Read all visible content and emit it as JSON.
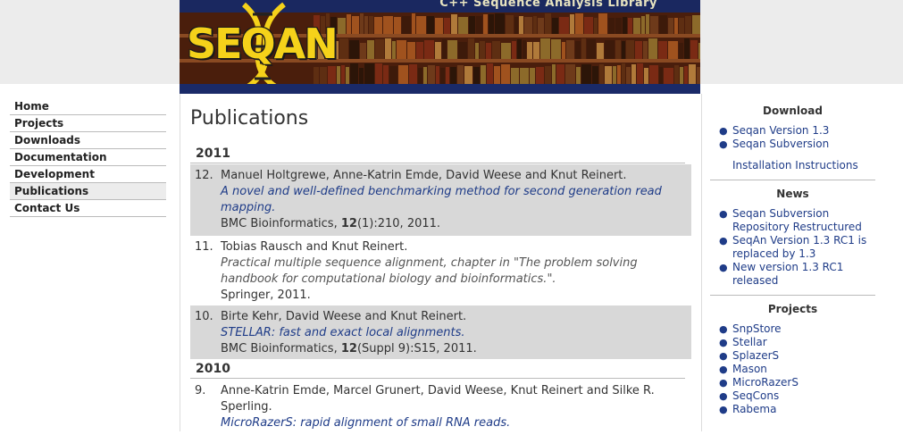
{
  "banner": {
    "tagline": "C++ Sequence Analysis Library",
    "logo": "SEQAN"
  },
  "leftnav": {
    "items": [
      "Home",
      "Projects",
      "Downloads",
      "Documentation",
      "Development",
      "Publications",
      "Contact Us"
    ],
    "active": "Publications"
  },
  "main": {
    "title": "Publications",
    "years": [
      {
        "year": "2011",
        "pubs": [
          {
            "num": "12.",
            "authors": "Manuel Holtgrewe, Anne-Katrin Emde, David Weese and Knut Reinert.",
            "title": "A novel and well-defined benchmarking method for second generation read mapping.",
            "venue_pre": "BMC Bioinformatics, ",
            "volume": "12",
            "venue_post": "(1):210, 2011."
          },
          {
            "num": "11.",
            "authors": "Tobias Rausch and Knut Reinert.",
            "title": "Practical multiple sequence alignment, chapter in \"The problem solving handbook for computational biology and bioinformatics.\".",
            "venue": "Springer, 2011."
          },
          {
            "num": "10.",
            "authors": "Birte Kehr, David Weese and Knut Reinert.",
            "title": "STELLAR: fast and exact local alignments.",
            "venue_pre": "BMC Bioinformatics, ",
            "volume": "12",
            "venue_post": "(Suppl 9):S15, 2011."
          }
        ]
      },
      {
        "year": "2010",
        "pubs": [
          {
            "num": "9.",
            "authors": "Anne-Katrin Emde, Marcel Grunert, David Weese, Knut Reinert and Silke R. Sperling.",
            "title": "MicroRazerS: rapid alignment of small RNA reads."
          }
        ]
      }
    ]
  },
  "rightbar": {
    "download": {
      "heading": "Download",
      "links": [
        "Seqan Version 1.3",
        "Seqan Subversion"
      ],
      "extra": "Installation Instructions"
    },
    "news": {
      "heading": "News",
      "links": [
        "Seqan Subversion Repository Restructured",
        "SeqAn Version 1.3 RC1 is replaced by 1.3",
        "New version 1.3 RC1 released"
      ]
    },
    "projects": {
      "heading": "Projects",
      "links": [
        "SnpStore",
        "Stellar",
        "SplazerS",
        "Mason",
        "MicroRazerS",
        "SeqCons",
        "Rabema"
      ]
    }
  },
  "colors": {
    "link": "#1f3c88",
    "shaded_row": "#d8d8d8",
    "banner_blue": "#1a2860",
    "logo_yellow": "#f5d21a"
  }
}
